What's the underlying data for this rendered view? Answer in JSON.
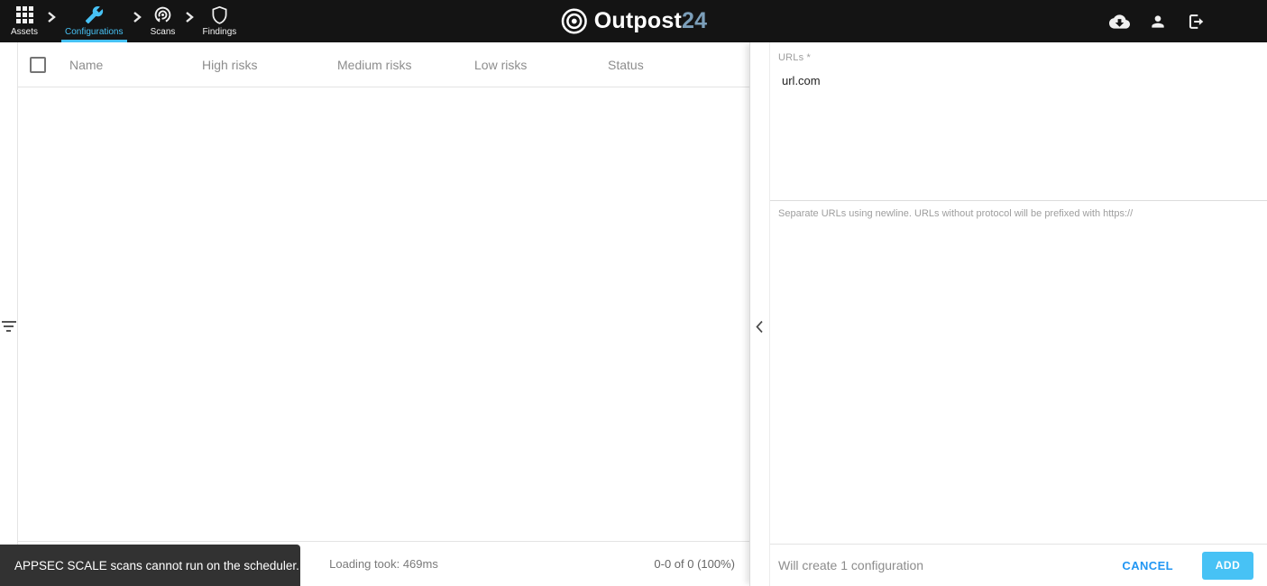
{
  "nav": {
    "items": [
      {
        "label": "Assets",
        "icon": "grid-icon",
        "active": false
      },
      {
        "label": "Configurations",
        "icon": "wrench-icon",
        "active": true
      },
      {
        "label": "Scans",
        "icon": "scan-target-icon",
        "active": false
      },
      {
        "label": "Findings",
        "icon": "shield-icon",
        "active": false
      }
    ],
    "logo": {
      "text_primary": "Outpost",
      "text_secondary": "24"
    },
    "right_icons": [
      "cloud-download-icon",
      "user-icon",
      "logout-icon"
    ]
  },
  "table": {
    "headers": [
      "Name",
      "High risks",
      "Medium risks",
      "Low risks",
      "Status"
    ],
    "rows": [],
    "footer": {
      "loading": "Loading took: 469ms",
      "range": "0-0 of 0 (100%)"
    }
  },
  "panel": {
    "urls_label": "URLs *",
    "urls_value": "url.com",
    "helper": "Separate URLs using newline. URLs without protocol will be prefixed with https://",
    "footer": {
      "summary": "Will create 1 configuration",
      "cancel_label": "CANCEL",
      "add_label": "ADD"
    }
  },
  "toast": {
    "message": "APPSEC SCALE scans cannot run on the scheduler."
  },
  "colors": {
    "accent": "#47c2f5",
    "link_blue": "#2196f3",
    "logo_secondary": "#7c9fba",
    "toast_bg": "#323232",
    "navbar_bg": "#141414"
  }
}
